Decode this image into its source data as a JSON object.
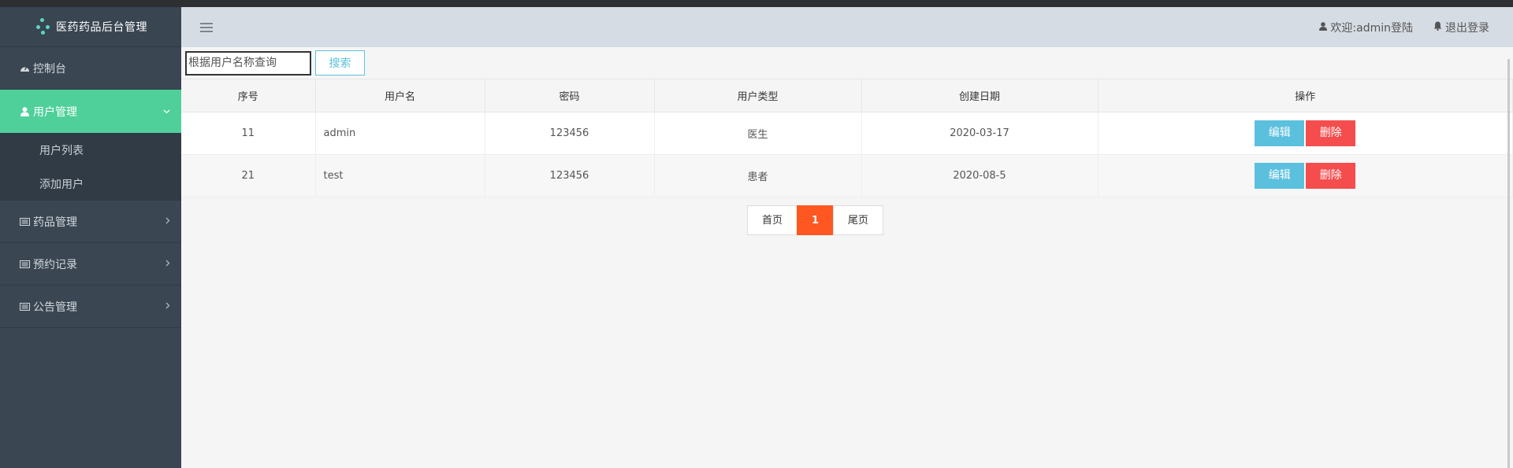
{
  "brand": {
    "title": "医药药品后台管理"
  },
  "sidebar": {
    "items": [
      {
        "label": "控制台",
        "icon": "dashboard-icon"
      },
      {
        "label": "用户管理",
        "icon": "user-icon",
        "active": true,
        "children": [
          {
            "label": "用户列表"
          },
          {
            "label": "添加用户"
          }
        ]
      },
      {
        "label": "药品管理",
        "icon": "list-icon"
      },
      {
        "label": "预约记录",
        "icon": "list-icon"
      },
      {
        "label": "公告管理",
        "icon": "list-icon"
      }
    ]
  },
  "header": {
    "welcome": "欢迎:admin登陆",
    "logout": "退出登录"
  },
  "search": {
    "placeholder": "根据用户名称查询",
    "button": "搜索"
  },
  "table": {
    "columns": [
      "序号",
      "用户名",
      "密码",
      "用户类型",
      "创建日期",
      "操作"
    ],
    "rows": [
      {
        "id": "11",
        "username": "admin",
        "password": "123456",
        "type": "医生",
        "created": "2020-03-17"
      },
      {
        "id": "21",
        "username": "test",
        "password": "123456",
        "type": "患者",
        "created": "2020-08-5"
      }
    ],
    "edit_label": "编辑",
    "delete_label": "删除"
  },
  "pagination": {
    "first": "首页",
    "current": "1",
    "last": "尾页"
  },
  "colors": {
    "accent": "#4fd09a",
    "sidebar": "#3a4652",
    "info": "#5bc0de",
    "danger": "#f54d4d",
    "page_active": "#ff5722"
  }
}
